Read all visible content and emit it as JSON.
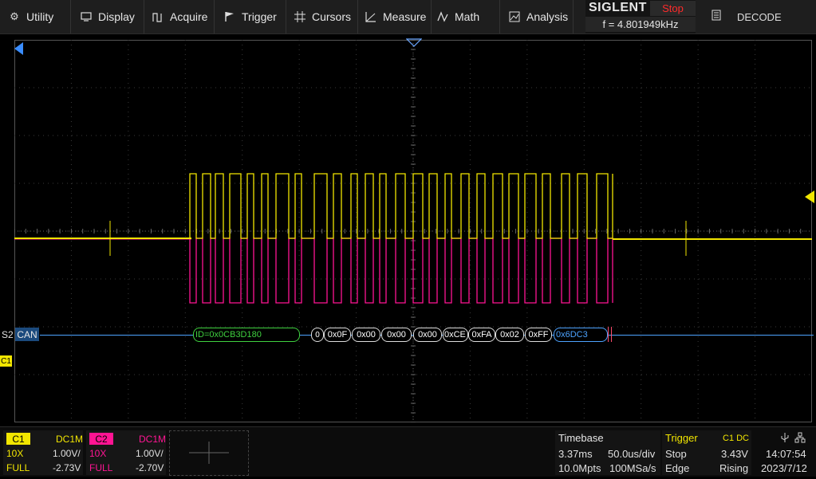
{
  "menu": {
    "utility": "Utility",
    "display": "Display",
    "acquire": "Acquire",
    "trigger": "Trigger",
    "cursors": "Cursors",
    "measure": "Measure",
    "math": "Math",
    "analysis": "Analysis",
    "decode": "DECODE"
  },
  "brand": {
    "name": "SIGLENT",
    "state": "Stop",
    "frequency": "f = 4.801949kHz"
  },
  "bus": {
    "slot": "S2",
    "protocol": "CAN",
    "frames": {
      "id": "ID=0x0CB3D180",
      "dlc": "0",
      "d1": "0x0F",
      "d2": "0x00",
      "d3": "0x00",
      "d4": "0x00",
      "d5": "0xCE",
      "d6": "0xFA",
      "d7": "0x02",
      "d8": "0xFF",
      "crc": "0x6DC3"
    }
  },
  "channel1": {
    "label": "C1",
    "coupling": "DC1M",
    "probe": "10X",
    "scale": "1.00V/",
    "bandwidth": "FULL",
    "offset": "-2.73V",
    "color": "#f2e600"
  },
  "channel2": {
    "label": "C2",
    "coupling": "DC1M",
    "probe": "10X",
    "scale": "1.00V/",
    "bandwidth": "FULL",
    "offset": "-2.70V",
    "color": "#ff1493"
  },
  "timebase": {
    "title": "Timebase",
    "delay": "3.37ms",
    "scale": "50.0us/div",
    "memory": "10.0Mpts",
    "samplerate": "100MSa/s"
  },
  "trigger": {
    "title": "Trigger",
    "source": "C1 DC",
    "mode": "Stop",
    "level": "3.43V",
    "type": "Edge",
    "slope": "Rising"
  },
  "status": {
    "time": "14:07:54",
    "date": "2023/7/12"
  },
  "colors": {
    "grid": "#3a3a3a",
    "bus": "#4da3ff",
    "id_frame": "#3fd13f",
    "crc_text": "#4da3ff"
  }
}
